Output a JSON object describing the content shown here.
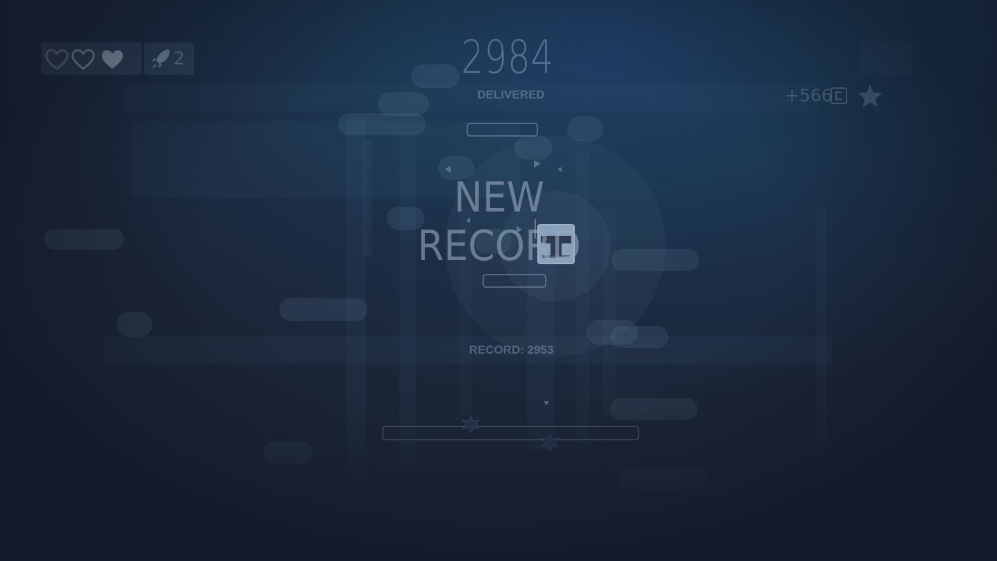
{
  "hud": {
    "lives_total": 3,
    "lives_remaining": 1,
    "boost_count": "2",
    "coins_delta": "+566",
    "heart_icon": "heart-icon",
    "rocket_icon": "rocket-icon",
    "coin_icon": "coin-icon",
    "star_icon": "star-icon"
  },
  "score": {
    "value": "2984",
    "label": "DELIVERED"
  },
  "banner": {
    "title": "NEW RECORD",
    "record_text": "RECORD: 2953"
  },
  "colors": {
    "background": "#1c2c44",
    "accent": "#2a4b6e",
    "text": "#8aa0b8"
  }
}
